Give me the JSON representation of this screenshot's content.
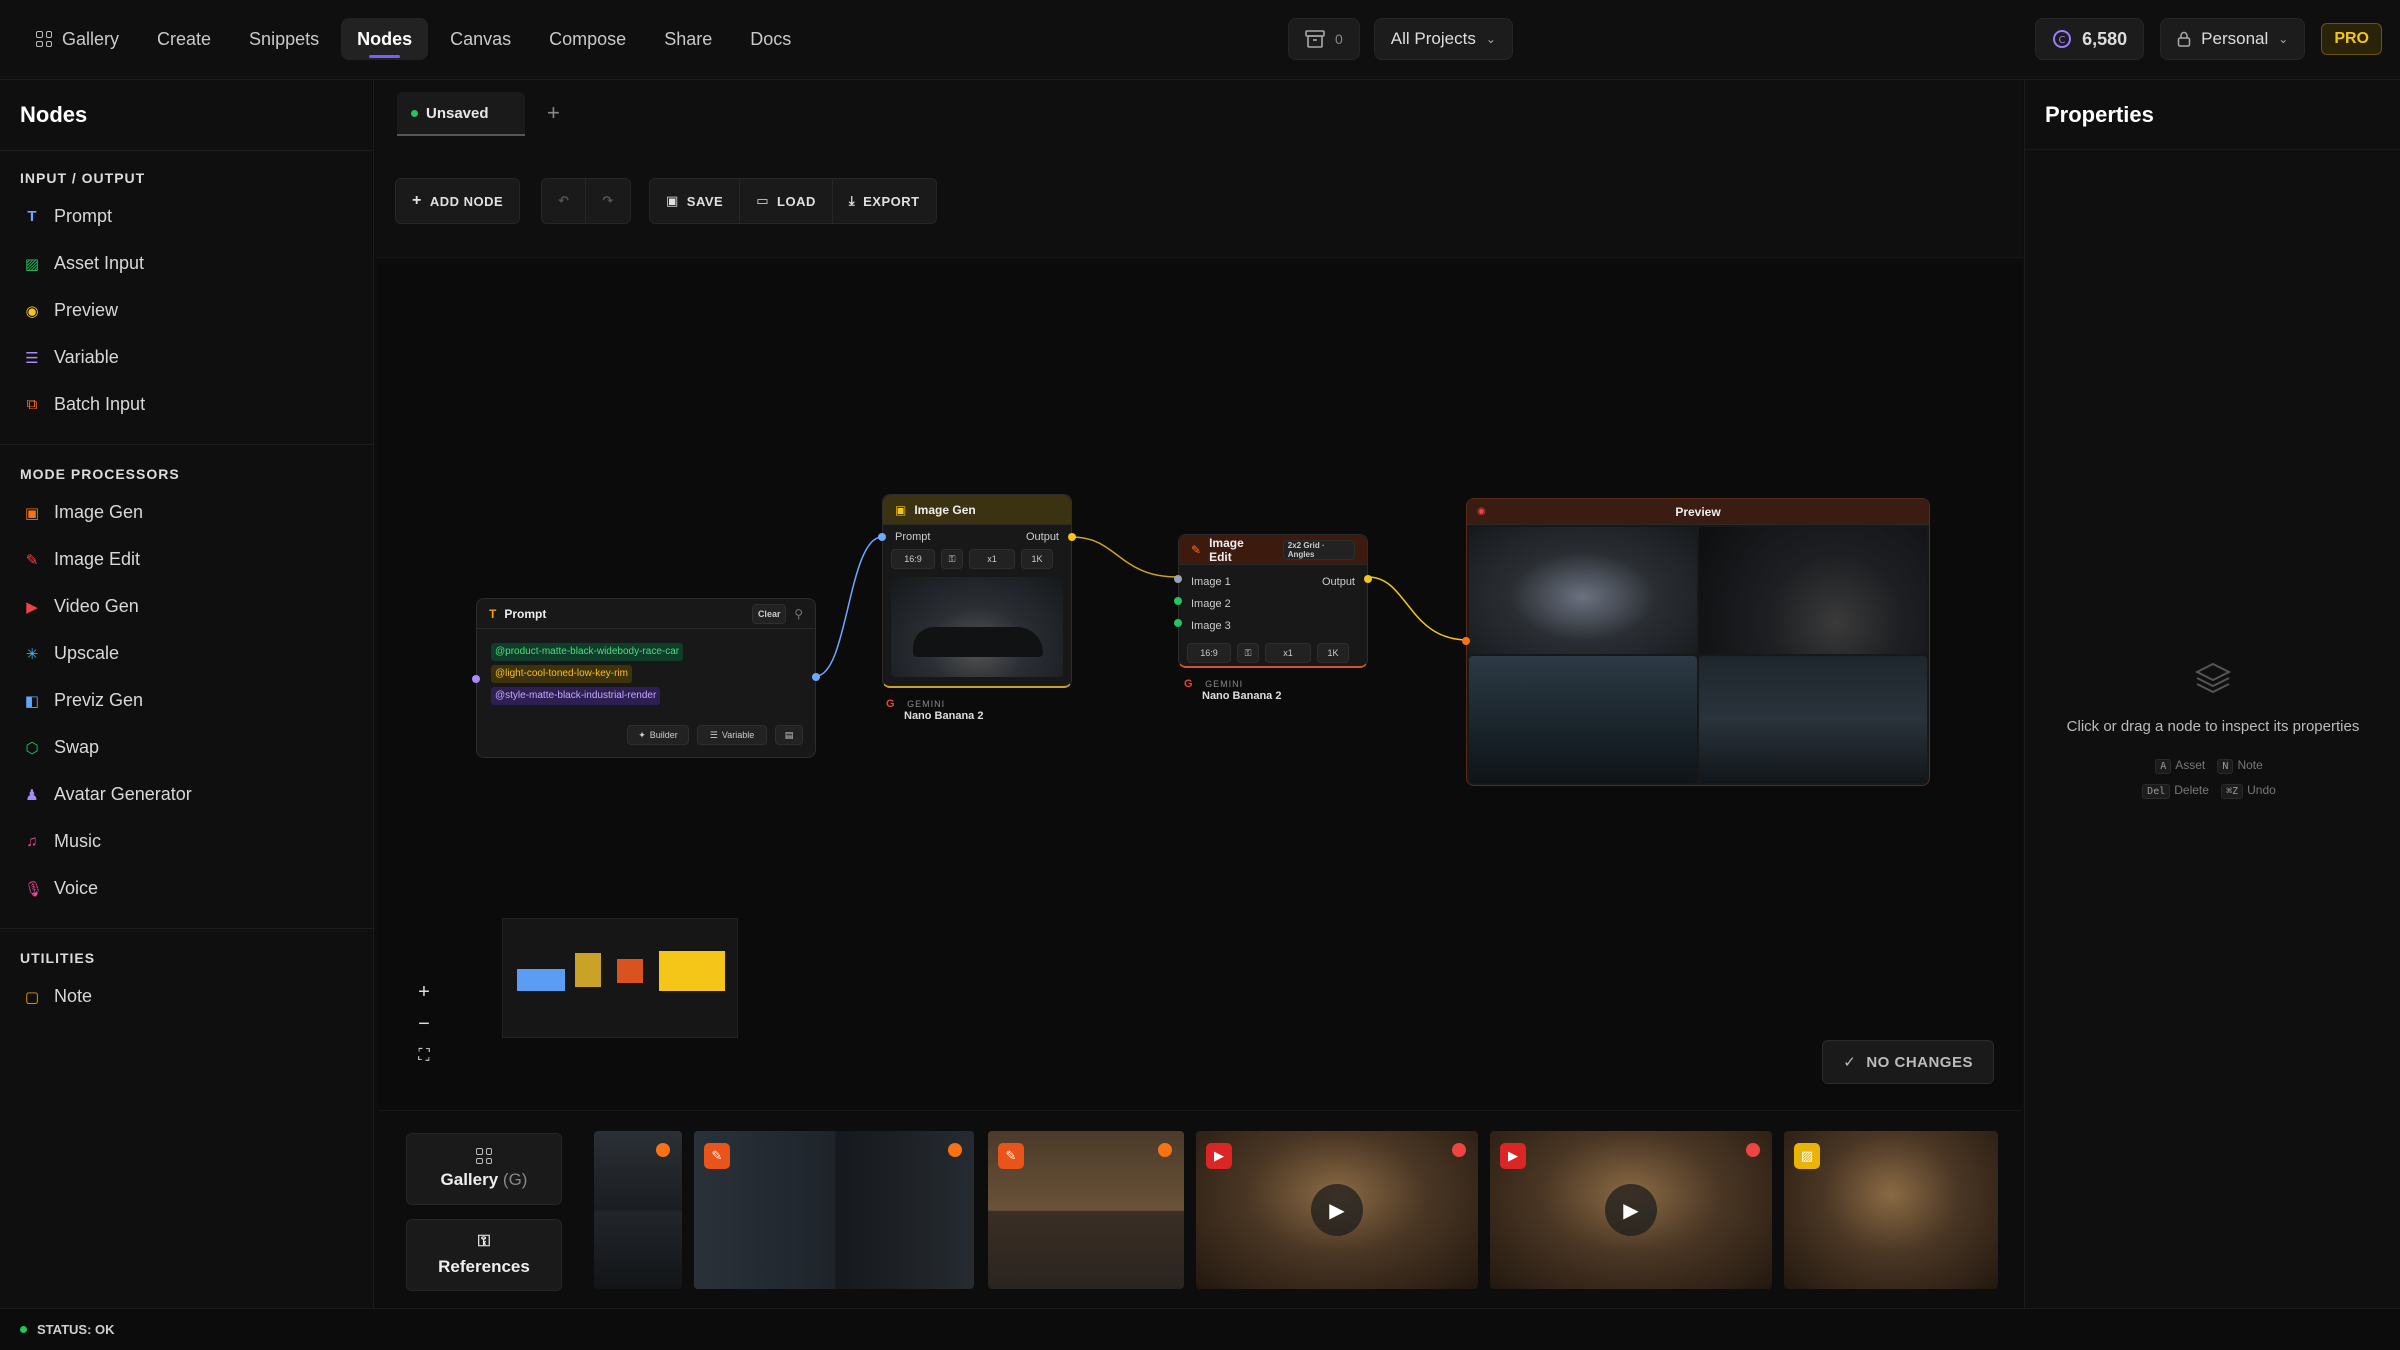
{
  "topnav": {
    "items": [
      "Gallery",
      "Create",
      "Snippets",
      "Nodes",
      "Canvas",
      "Compose",
      "Share",
      "Docs"
    ],
    "active": "Nodes"
  },
  "topcenter": {
    "archive_count": "0",
    "project_select": "All Projects"
  },
  "topright": {
    "credits": "6,580",
    "workspace": "Personal",
    "plan_badge": "PRO"
  },
  "sidebar": {
    "title": "Nodes",
    "sections": [
      {
        "heading": "INPUT / OUTPUT",
        "items": [
          "Prompt",
          "Asset Input",
          "Preview",
          "Variable",
          "Batch Input"
        ]
      },
      {
        "heading": "MODE PROCESSORS",
        "items": [
          "Image Gen",
          "Image Edit",
          "Video Gen",
          "Upscale",
          "Previz Gen",
          "Swap",
          "Avatar Generator",
          "Music",
          "Voice"
        ]
      },
      {
        "heading": "UTILITIES",
        "items": [
          "Note"
        ]
      }
    ]
  },
  "tabs": {
    "current": "Unsaved"
  },
  "toolbar": {
    "add_node": "ADD NODE",
    "save": "SAVE",
    "load": "LOAD",
    "export": "EXPORT"
  },
  "nodes": {
    "prompt": {
      "title": "Prompt",
      "clear": "Clear",
      "chips": [
        "@product-matte-black-widebody-race-car",
        "@light-cool-toned-low-key-rim",
        "@style-matte-black-industrial-render"
      ],
      "builder": "Builder",
      "variable": "Variable"
    },
    "image_gen": {
      "title": "Image Gen",
      "in": "Prompt",
      "out": "Output",
      "ratio": "16:9",
      "count": "x1",
      "res": "1K",
      "provider": "GEMINI",
      "model": "Nano Banana 2"
    },
    "image_edit": {
      "title": "Image Edit",
      "mode": "2x2 Grid · Angles",
      "in1": "Image 1",
      "in2": "Image 2",
      "in3": "Image 3",
      "out": "Output",
      "ratio": "16:9",
      "count": "x1",
      "res": "1K",
      "provider": "GEMINI",
      "model": "Nano Banana 2"
    },
    "preview": {
      "title": "Preview"
    }
  },
  "canvas": {
    "no_changes": "NO CHANGES"
  },
  "properties": {
    "title": "Properties",
    "empty": "Click or drag a node to inspect its properties",
    "keys": [
      {
        "key": "A",
        "label": "Asset"
      },
      {
        "key": "N",
        "label": "Note"
      },
      {
        "key": "Del",
        "label": "Delete"
      },
      {
        "key": "⌘Z",
        "label": "Undo"
      }
    ]
  },
  "strip": {
    "gallery": "Gallery",
    "gallery_key": "(G)",
    "references": "References"
  },
  "status": {
    "text": "STATUS: OK"
  },
  "colors": {
    "accent": "#7c5cff",
    "image_gen": "#c9a227",
    "image_edit": "#d9531e",
    "preview": "#f5c518",
    "status_ok": "#22c55e"
  }
}
